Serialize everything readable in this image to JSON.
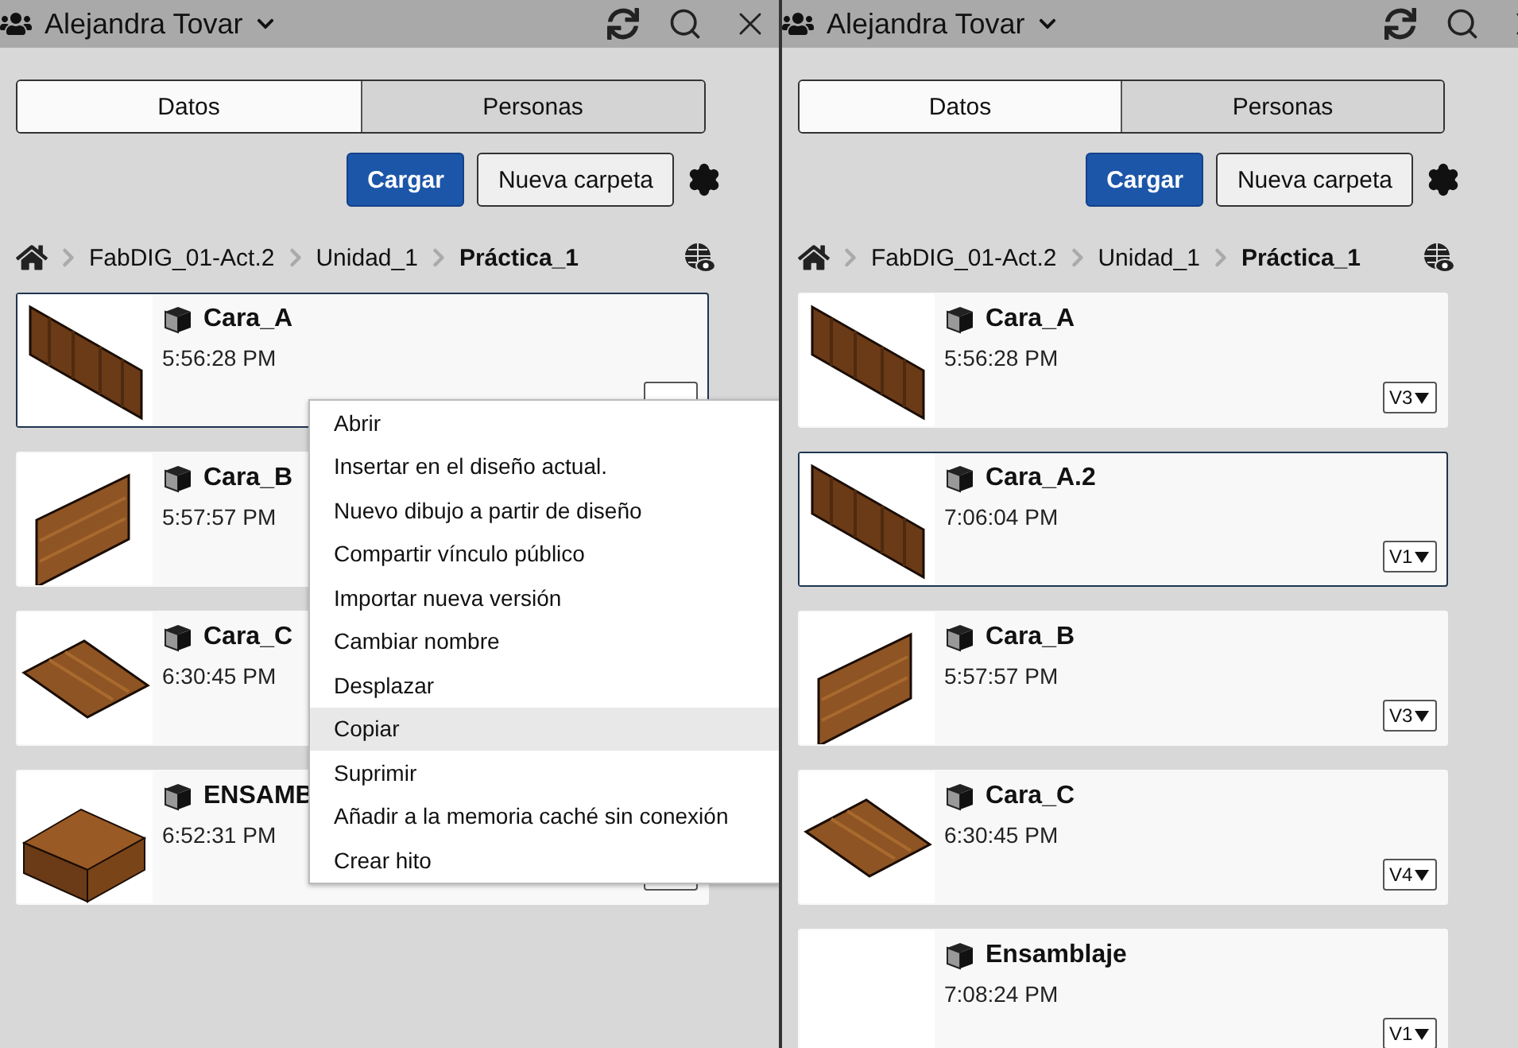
{
  "panels": [
    {
      "header": {
        "user": "Alejandra Tovar"
      },
      "tabs": [
        {
          "label": "Datos",
          "selected": true
        },
        {
          "label": "Personas",
          "selected": false
        }
      ],
      "upload_button": "Cargar",
      "new_folder_button": "Nueva carpeta",
      "breadcrumb": [
        "FabDIG_01-Act.2",
        "Unidad_1",
        "Práctica_1"
      ],
      "items": [
        {
          "name": "Cara_A",
          "time": "5:56:28 PM",
          "kind": "slanted",
          "selected": true,
          "context_menu": [
            {
              "label": "Abrir",
              "selected": false
            },
            {
              "label": "Insertar en el diseño actual.",
              "selected": false
            },
            {
              "label": "Nuevo dibujo a partir de diseño",
              "selected": false
            },
            {
              "label": "Compartir vínculo público",
              "selected": false
            },
            {
              "label": "Importar nueva versión",
              "selected": false
            },
            {
              "label": "Cambiar nombre",
              "selected": false
            },
            {
              "label": "Desplazar",
              "selected": false
            },
            {
              "label": "Copiar",
              "selected": true
            },
            {
              "label": "Suprimir",
              "selected": false
            },
            {
              "label": "Añadir a la memoria caché sin conexión",
              "selected": false
            },
            {
              "label": "Crear hito",
              "selected": false
            }
          ]
        },
        {
          "name": "Cara_B",
          "time": "5:57:57 PM",
          "kind": "upright",
          "selected": false
        },
        {
          "name": "Cara_C",
          "time": "6:30:45 PM",
          "kind": "flat",
          "selected": false
        },
        {
          "name": "ENSAMB",
          "time": "6:52:31 PM",
          "kind": "block",
          "selected": false
        }
      ]
    },
    {
      "header": {
        "user": "Alejandra Tovar"
      },
      "tabs": [
        {
          "label": "Datos",
          "selected": true
        },
        {
          "label": "Personas",
          "selected": false
        }
      ],
      "upload_button": "Cargar",
      "new_folder_button": "Nueva carpeta",
      "breadcrumb": [
        "FabDIG_01-Act.2",
        "Unidad_1",
        "Práctica_1"
      ],
      "items": [
        {
          "name": "Cara_A",
          "time": "5:56:28 PM",
          "version": "V3",
          "kind": "slanted",
          "selected": false
        },
        {
          "name": "Cara_A.2",
          "time": "7:06:04 PM",
          "version": "V1",
          "kind": "slanted",
          "selected": true
        },
        {
          "name": "Cara_B",
          "time": "5:57:57 PM",
          "version": "V3",
          "kind": "upright",
          "selected": false
        },
        {
          "name": "Cara_C",
          "time": "6:30:45 PM",
          "version": "V4",
          "kind": "flat",
          "selected": false
        },
        {
          "name": "Ensamblaje",
          "time": "7:08:24 PM",
          "version": "V1",
          "kind": "empty",
          "selected": false
        }
      ]
    }
  ]
}
